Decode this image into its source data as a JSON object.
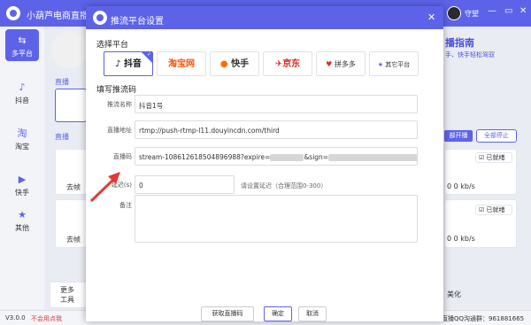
{
  "app": {
    "title": "小葫芦电商直播助手",
    "user_name": "守望"
  },
  "sidebar": {
    "items": [
      {
        "label": "多平台",
        "icon": "multi-platform-icon",
        "active": true
      },
      {
        "label": "抖音",
        "icon": "douyin-icon"
      },
      {
        "label": "淘宝",
        "icon": "taobao-icon"
      },
      {
        "label": "快手",
        "icon": "kuaishou-icon"
      },
      {
        "label": "其他",
        "icon": "star-icon"
      }
    ]
  },
  "background": {
    "banner_title": "播指南",
    "banner_sub": "手、快手轻松驾驭",
    "live_label": "直播",
    "live_label2": "直播",
    "start_all": "部开播",
    "stop_all": "全部停止",
    "status_ready": "已就绪",
    "bitrate_1": "0  0 kb/s",
    "bitrate_2": "0  0 kb/s",
    "row_label": "去帧",
    "more_tools": "更多\n工具",
    "beautify": "美化",
    "qq_group": "直播QQ沟通群：961881665"
  },
  "footer": {
    "version": "V3.0.0",
    "link": "不会用点我"
  },
  "modal": {
    "title": "推流平台设置",
    "select_platform": "选择平台",
    "fill_code": "填写推流码",
    "platforms": [
      {
        "label": "抖音",
        "selected": true
      },
      {
        "label": "淘宝网"
      },
      {
        "label": "快手"
      },
      {
        "label": "京东"
      },
      {
        "label": "拼多多"
      },
      {
        "label": "其它平台"
      }
    ],
    "fields": {
      "name_label": "推流名称",
      "name_value": "抖音1号",
      "addr_label": "直播地址",
      "addr_value": "rtmp://push-rtmp-l11.douyincdn.com/third",
      "code_label": "直播码",
      "code_value_1": "stream-108612618504896988?expire=",
      "code_value_2": "&sign=",
      "delay_label": "延迟(s)",
      "delay_value": "0",
      "delay_hint": "请设置延迟（合理范围0-300）",
      "note_label": "备注",
      "note_value": ""
    },
    "buttons": {
      "get_code": "获取直播码",
      "confirm": "确定",
      "cancel": "取消"
    }
  },
  "colors": {
    "accent": "#5d63e8",
    "arrow": "#e53935",
    "douyin": "#111111",
    "taobao": "#ff5000",
    "kuaishou": "#ff6a00",
    "jd": "#e1251b",
    "pdd": "#e02e24",
    "other": "#5d63e8"
  }
}
